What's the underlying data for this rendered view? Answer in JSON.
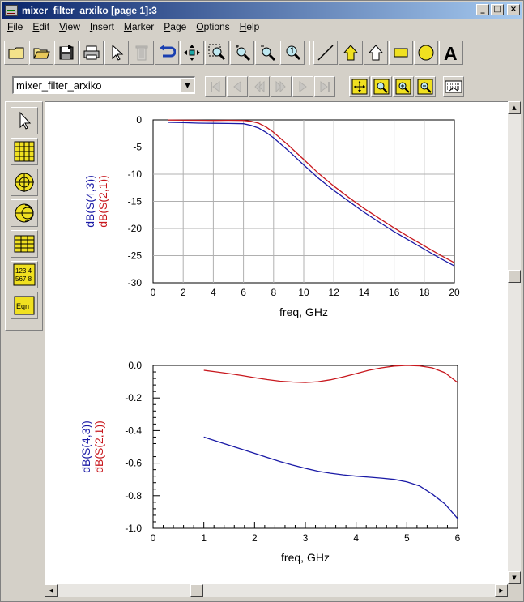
{
  "window": {
    "title": "mixer_filter_arxiko [page 1]:3",
    "controls": [
      "_",
      "□",
      "×"
    ]
  },
  "menu": [
    "File",
    "Edit",
    "View",
    "Insert",
    "Marker",
    "Page",
    "Options",
    "Help"
  ],
  "menu_mnemonics": [
    "F",
    "E",
    "V",
    "I",
    "M",
    "P",
    "O",
    "H"
  ],
  "design_select": {
    "value": "mixer_filter_arxiko"
  },
  "toolbar_icons": [
    "new-icon",
    "open-icon",
    "save-icon",
    "print-icon",
    "select-arrow-icon",
    "delete-icon",
    "undo-icon",
    "pan-icon",
    "zoom-area-icon",
    "zoom-in-icon",
    "zoom-out-icon",
    "zoom-fit-icon",
    "line-icon",
    "polyline-icon",
    "polygon-icon",
    "rectangle-icon",
    "circle-icon",
    "text-icon"
  ],
  "palette_icons": [
    "pointer-icon",
    "rectangular-plot-icon",
    "polar-plot-icon",
    "smith-chart-icon",
    "list-icon",
    "stack-icon",
    "equation-icon"
  ],
  "palette_labels": {
    "stack": "123 4 567 8",
    "equation": "Eqn"
  },
  "colors": {
    "s43": "#1a1aa6",
    "s21": "#c8181e",
    "grid": "#b0b0b0"
  },
  "chart_data": [
    {
      "type": "line",
      "xlabel": "freq, GHz",
      "ylabel_lines": [
        "dB(S(4,3))",
        "dB(S(2,1))"
      ],
      "xlim": [
        0,
        20
      ],
      "ylim": [
        -30,
        0
      ],
      "xticks": [
        "0",
        "2",
        "4",
        "6",
        "8",
        "10",
        "12",
        "14",
        "16",
        "18",
        "20"
      ],
      "yticks": [
        "0",
        "-5",
        "-10",
        "-15",
        "-20",
        "-25",
        "-30"
      ],
      "grid": true,
      "series": [
        {
          "name": "dB(S(4,3))",
          "color": "#1a1aa6",
          "x": [
            1,
            2,
            3,
            4,
            5,
            6,
            6.5,
            7,
            7.5,
            8,
            9,
            10,
            11,
            12,
            13,
            14,
            15,
            16,
            17,
            18,
            19,
            20
          ],
          "y": [
            -0.45,
            -0.5,
            -0.6,
            -0.62,
            -0.65,
            -0.7,
            -1.0,
            -1.5,
            -2.3,
            -3.3,
            -5.7,
            -8.3,
            -10.8,
            -13.0,
            -15.0,
            -17.0,
            -18.8,
            -20.6,
            -22.2,
            -23.8,
            -25.4,
            -26.9
          ]
        },
        {
          "name": "dB(S(2,1))",
          "color": "#c8181e",
          "x": [
            1,
            2,
            3,
            4,
            5,
            6,
            6.5,
            7,
            7.5,
            8,
            9,
            10,
            11,
            12,
            13,
            14,
            15,
            16,
            17,
            18,
            19,
            20
          ],
          "y": [
            -0.03,
            -0.06,
            -0.08,
            -0.1,
            -0.08,
            -0.1,
            -0.25,
            -0.6,
            -1.3,
            -2.3,
            -4.7,
            -7.3,
            -9.9,
            -12.2,
            -14.3,
            -16.3,
            -18.1,
            -19.9,
            -21.6,
            -23.2,
            -24.8,
            -26.3
          ]
        }
      ]
    },
    {
      "type": "line",
      "xlabel": "freq, GHz",
      "ylabel_lines": [
        "dB(S(4,3))",
        "dB(S(2,1))"
      ],
      "xlim": [
        0,
        6
      ],
      "ylim": [
        -1.0,
        0.0
      ],
      "xticks": [
        "0",
        "1",
        "2",
        "3",
        "4",
        "5",
        "6"
      ],
      "yticks": [
        "0.0",
        "-0.2",
        "-0.4",
        "-0.6",
        "-0.8",
        "-1.0"
      ],
      "grid": false,
      "series": [
        {
          "name": "dB(S(4,3))",
          "color": "#1a1aa6",
          "x": [
            1.0,
            1.25,
            1.5,
            1.75,
            2.0,
            2.25,
            2.5,
            2.75,
            3.0,
            3.25,
            3.5,
            3.75,
            4.0,
            4.25,
            4.5,
            4.75,
            5.0,
            5.25,
            5.5,
            5.75,
            6.0
          ],
          "y": [
            -0.44,
            -0.465,
            -0.49,
            -0.515,
            -0.54,
            -0.565,
            -0.59,
            -0.612,
            -0.632,
            -0.65,
            -0.662,
            -0.672,
            -0.68,
            -0.686,
            -0.692,
            -0.7,
            -0.715,
            -0.74,
            -0.79,
            -0.85,
            -0.94
          ]
        },
        {
          "name": "dB(S(2,1))",
          "color": "#c8181e",
          "x": [
            1.0,
            1.25,
            1.5,
            1.75,
            2.0,
            2.25,
            2.5,
            2.75,
            3.0,
            3.25,
            3.5,
            3.75,
            4.0,
            4.25,
            4.5,
            4.75,
            5.0,
            5.25,
            5.5,
            5.75,
            6.0
          ],
          "y": [
            -0.03,
            -0.04,
            -0.05,
            -0.062,
            -0.075,
            -0.087,
            -0.097,
            -0.102,
            -0.105,
            -0.1,
            -0.088,
            -0.07,
            -0.05,
            -0.03,
            -0.015,
            -0.004,
            0.0,
            -0.003,
            -0.015,
            -0.045,
            -0.105
          ]
        }
      ]
    }
  ]
}
